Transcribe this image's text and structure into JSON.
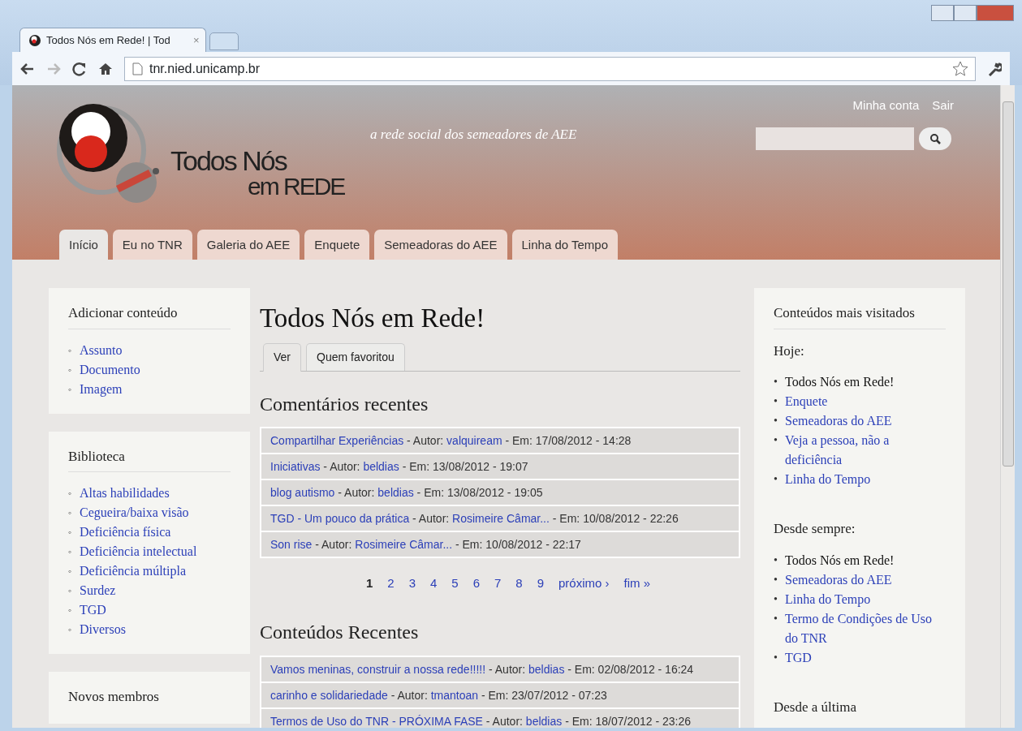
{
  "browser": {
    "tab_title": "Todos Nós em Rede! | Tod",
    "tab_close": "×",
    "url": "tnr.nied.unicamp.br"
  },
  "header": {
    "logo_line1": "Todos Nós",
    "logo_line2": "em REDE",
    "slogan": "a rede social dos semeadores de AEE",
    "user_links": [
      "Minha conta",
      "Sair"
    ]
  },
  "nav_tabs": [
    {
      "label": "Início",
      "selected": true
    },
    {
      "label": "Eu no TNR",
      "selected": false
    },
    {
      "label": "Galeria do AEE",
      "selected": false
    },
    {
      "label": "Enquete",
      "selected": false
    },
    {
      "label": "Semeadoras do AEE",
      "selected": false
    },
    {
      "label": "Linha do Tempo",
      "selected": false
    }
  ],
  "left_blocks": [
    {
      "title": "Adicionar conteúdo",
      "items": [
        {
          "marker": "◦",
          "text": "Assunto"
        },
        {
          "marker": "◦",
          "text": "Documento"
        },
        {
          "marker": "◦",
          "text": "Imagem"
        }
      ]
    },
    {
      "title": "Biblioteca",
      "items": [
        {
          "marker": "◦",
          "text": "Altas habilidades"
        },
        {
          "marker": "◦",
          "text": "Cegueira/baixa visão"
        },
        {
          "marker": "◦",
          "text": "Deficiência física"
        },
        {
          "marker": "◦",
          "text": "Deficiência intelectual"
        },
        {
          "marker": "◦",
          "text": "Deficiência múltipla"
        },
        {
          "marker": "◦",
          "text": "Surdez"
        },
        {
          "marker": "◦",
          "text": "TGD"
        },
        {
          "marker": "◦",
          "text": "Diversos"
        }
      ]
    },
    {
      "title": "Novos membros"
    }
  ],
  "main": {
    "title": "Todos Nós em Rede!",
    "tabs": [
      {
        "label": "Ver",
        "selected": true
      },
      {
        "label": "Quem favoritou",
        "selected": false
      }
    ],
    "sections": [
      {
        "heading": "Comentários recentes",
        "rows": [
          {
            "parts": [
              {
                "text": "Compartilhar Experiências",
                "link": true
              },
              {
                "text": "- Autor:",
                "link": false
              },
              {
                "text": "valquiream",
                "link": true
              },
              {
                "text": "- Em: 17/08/2012 - 14:28",
                "link": false
              }
            ]
          },
          {
            "parts": [
              {
                "text": "Iniciativas",
                "link": true
              },
              {
                "text": "- Autor:",
                "link": false
              },
              {
                "text": "beldias",
                "link": true
              },
              {
                "text": "- Em: 13/08/2012 - 19:07",
                "link": false
              }
            ]
          },
          {
            "parts": [
              {
                "text": "blog autismo",
                "link": true
              },
              {
                "text": "- Autor:",
                "link": false
              },
              {
                "text": "beldias",
                "link": true
              },
              {
                "text": "- Em: 13/08/2012 - 19:05",
                "link": false
              }
            ]
          },
          {
            "parts": [
              {
                "text": "TGD - Um pouco da prática",
                "link": true
              },
              {
                "text": "- Autor:",
                "link": false
              },
              {
                "text": "Rosimeire Câmar...",
                "link": true
              },
              {
                "text": "- Em: 10/08/2012 - 22:26",
                "link": false
              }
            ]
          },
          {
            "parts": [
              {
                "text": "Son rise",
                "link": true
              },
              {
                "text": "- Autor:",
                "link": false
              },
              {
                "text": "Rosimeire Câmar...",
                "link": true
              },
              {
                "text": "- Em: 10/08/2012 - 22:17",
                "link": false
              }
            ]
          }
        ],
        "pager": [
          {
            "label": "1",
            "selected": true
          },
          {
            "label": "2",
            "selected": false
          },
          {
            "label": "3",
            "selected": false
          },
          {
            "label": "4",
            "selected": false
          },
          {
            "label": "5",
            "selected": false
          },
          {
            "label": "6",
            "selected": false
          },
          {
            "label": "7",
            "selected": false
          },
          {
            "label": "8",
            "selected": false
          },
          {
            "label": "9",
            "selected": false
          },
          {
            "label": "próximo ›",
            "selected": false
          },
          {
            "label": "fim »",
            "selected": false
          }
        ]
      },
      {
        "heading": "Conteúdos Recentes",
        "rows": [
          {
            "parts": [
              {
                "text": "Vamos meninas, construir a nossa rede!!!!!",
                "link": true
              },
              {
                "text": "- Autor:",
                "link": false
              },
              {
                "text": "beldias",
                "link": true
              },
              {
                "text": "- Em: 02/08/2012 - 16:24",
                "link": false
              }
            ]
          },
          {
            "parts": [
              {
                "text": "carinho e solidariedade",
                "link": true
              },
              {
                "text": "- Autor:",
                "link": false
              },
              {
                "text": "tmantoan",
                "link": true
              },
              {
                "text": "- Em: 23/07/2012 - 07:23",
                "link": false
              }
            ]
          },
          {
            "parts": [
              {
                "text": "Termos de Uso do TNR - PRÓXIMA FASE",
                "link": true
              },
              {
                "text": "- Autor:",
                "link": false
              },
              {
                "text": "beldias",
                "link": true
              },
              {
                "text": "- Em: 18/07/2012 - 23:26",
                "link": false
              }
            ]
          }
        ]
      }
    ]
  },
  "right_block": {
    "title": "Conteúdos mais visitados",
    "groups": [
      {
        "heading": "Hoje:",
        "items": [
          {
            "marker": "•",
            "text": "Todos Nós em Rede!",
            "link": false
          },
          {
            "marker": "•",
            "text": "Enquete",
            "link": true
          },
          {
            "marker": "•",
            "text": "Semeadoras do AEE",
            "link": true
          },
          {
            "marker": "•",
            "text": "Veja a pessoa, não a deficiência",
            "link": true
          },
          {
            "marker": "•",
            "text": "Linha do Tempo",
            "link": true
          }
        ]
      },
      {
        "heading": "Desde sempre:",
        "items": [
          {
            "marker": "•",
            "text": "Todos Nós em Rede!",
            "link": false
          },
          {
            "marker": "•",
            "text": "Semeadoras do AEE",
            "link": true
          },
          {
            "marker": "•",
            "text": "Linha do Tempo",
            "link": true
          },
          {
            "marker": "•",
            "text": "Termo de Condições de Uso do TNR",
            "link": true
          },
          {
            "marker": "•",
            "text": "TGD",
            "link": true
          }
        ]
      },
      {
        "heading": "Desde a última"
      }
    ]
  }
}
